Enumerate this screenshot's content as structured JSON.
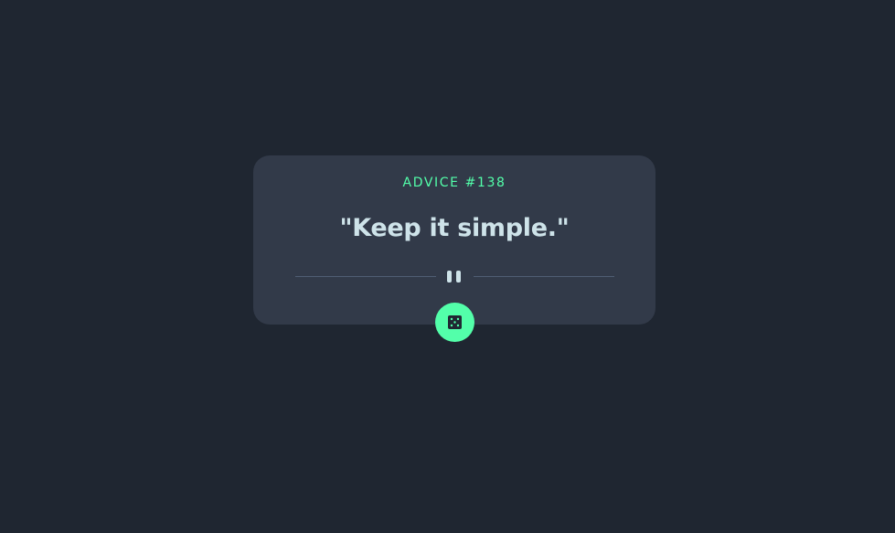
{
  "card": {
    "advice_label": "ADVICE #138",
    "advice_text": "\"Keep it simple.\""
  },
  "icons": {
    "divider": "pause-icon",
    "button": "dice-icon"
  },
  "colors": {
    "background": "#1f2631",
    "card": "#323a49",
    "accent": "#53ffaa",
    "text": "#cee3e9",
    "divider": "#4f5d74"
  }
}
